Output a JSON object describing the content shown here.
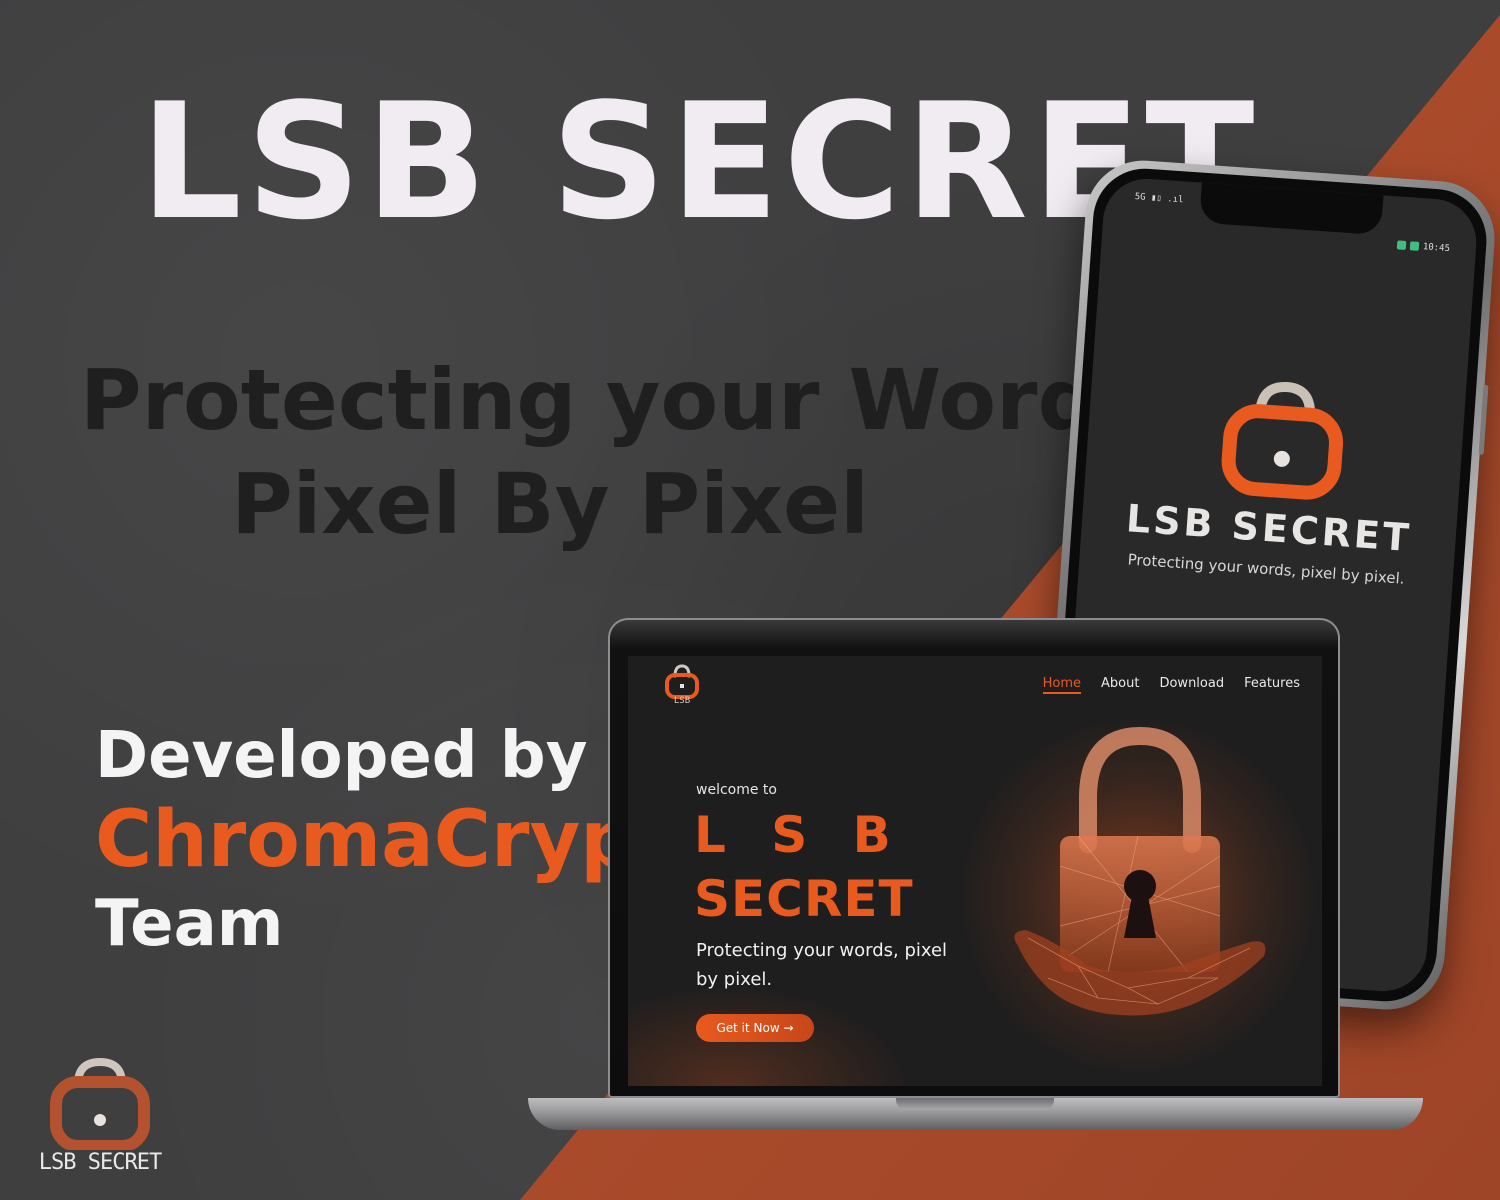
{
  "colors": {
    "background": "#3f3f40",
    "accent": "#e85a1e",
    "accent_dark": "#b4522f",
    "headline": "#f1ebf2",
    "tagline": "#1f1f20"
  },
  "hero": {
    "title": "LSB SECRET",
    "tagline_lines": [
      "Protecting your Words",
      "Pixel By Pixel"
    ]
  },
  "developer": {
    "line1": "Developed by",
    "team_name": "ChromaCrypt",
    "line3": "Team"
  },
  "corner_logo": {
    "icon": "padlock-icon",
    "label": "LSB SECRET"
  },
  "phone": {
    "status_left": "5G ▮▯ .ıl",
    "status_right": "10:45",
    "app_name": "LSB SECRET",
    "tagline": "Protecting your words, pixel by pixel."
  },
  "laptop_site": {
    "logo_label": "LSB",
    "nav": [
      {
        "label": "Home",
        "active": true
      },
      {
        "label": "About",
        "active": false
      },
      {
        "label": "Download",
        "active": false
      },
      {
        "label": "Features",
        "active": false
      }
    ],
    "welcome": "welcome to",
    "title_line1": "L S B",
    "title_line2": "SECRET",
    "tagline": "Protecting your words, pixel by pixel.",
    "cta_label": "Get it Now  →",
    "hero_art_icon": "padlock-in-hand-icon"
  }
}
